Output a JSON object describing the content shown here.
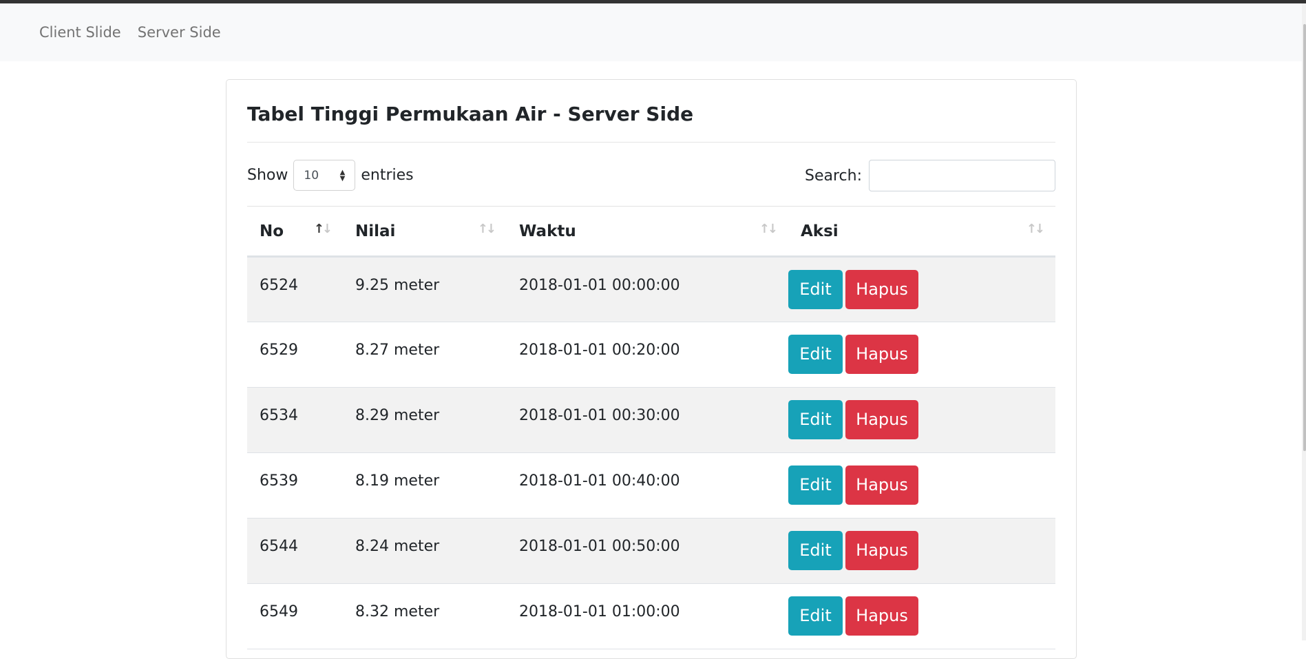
{
  "nav": {
    "links": [
      "Client Slide",
      "Server Side"
    ]
  },
  "card": {
    "title": "Tabel Tinggi Permukaan Air - Server Side"
  },
  "length": {
    "show_label": "Show",
    "value": "10",
    "entries_label": "entries"
  },
  "search": {
    "label": "Search:",
    "value": "",
    "placeholder": ""
  },
  "table": {
    "headers": [
      "No",
      "Nilai",
      "Waktu",
      "Aksi"
    ],
    "sort": {
      "active_column": "No",
      "direction": "ascending"
    },
    "rows": [
      {
        "no": "6524",
        "nilai": "9.25 meter",
        "waktu": "2018-01-01 00:00:00"
      },
      {
        "no": "6529",
        "nilai": "8.27 meter",
        "waktu": "2018-01-01 00:20:00"
      },
      {
        "no": "6534",
        "nilai": "8.29 meter",
        "waktu": "2018-01-01 00:30:00"
      },
      {
        "no": "6539",
        "nilai": "8.19 meter",
        "waktu": "2018-01-01 00:40:00"
      },
      {
        "no": "6544",
        "nilai": "8.24 meter",
        "waktu": "2018-01-01 00:50:00"
      },
      {
        "no": "6549",
        "nilai": "8.32 meter",
        "waktu": "2018-01-01 01:00:00"
      }
    ],
    "actions": {
      "edit_label": "Edit",
      "delete_label": "Hapus"
    }
  },
  "colors": {
    "navbar_bg": "#f8f9fa",
    "edit_button": "#17a2b8",
    "delete_button": "#dc3545",
    "striped_row": "#f2f2f2"
  },
  "icons": {
    "sort": "sort-arrows-icon",
    "select": "select-arrows-icon"
  }
}
